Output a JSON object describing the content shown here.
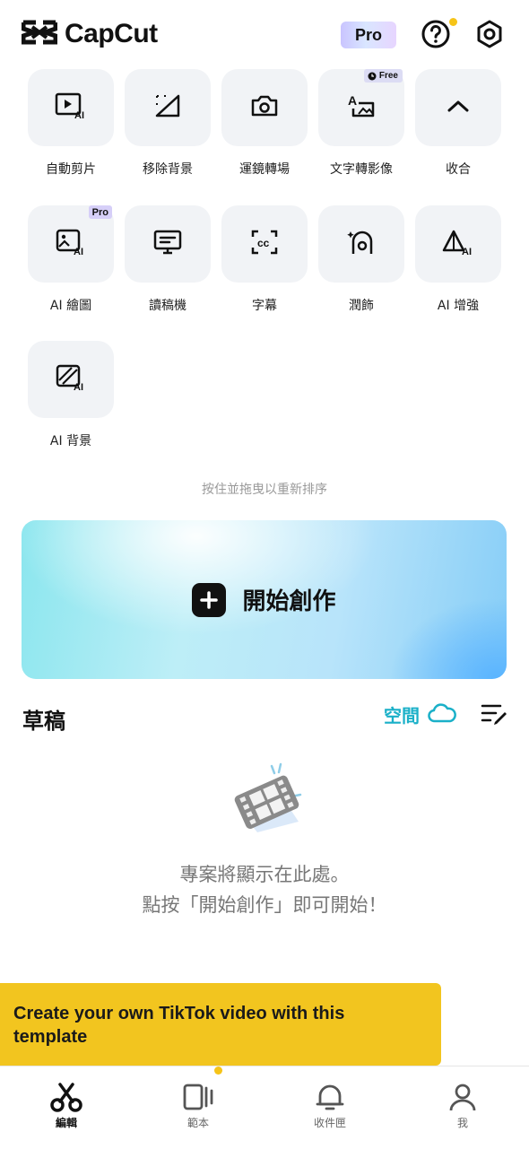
{
  "header": {
    "app_name": "CapCut",
    "pro_badge": "Pro"
  },
  "tools": [
    {
      "label": "自動剪片",
      "icon": "auto-cut-icon"
    },
    {
      "label": "移除背景",
      "icon": "remove-background-icon"
    },
    {
      "label": "運鏡轉場",
      "icon": "camera-icon"
    },
    {
      "label": "文字轉影像",
      "icon": "text-to-image-icon",
      "tag": "Free"
    },
    {
      "label": "收合",
      "icon": "chevron-up-icon"
    },
    {
      "label": "AI 繪圖",
      "icon": "ai-drawing-icon",
      "tag": "Pro"
    },
    {
      "label": "讀稿機",
      "icon": "teleprompter-icon"
    },
    {
      "label": "字幕",
      "icon": "captions-icon"
    },
    {
      "label": "潤飾",
      "icon": "retouch-icon"
    },
    {
      "label": "AI 增強",
      "icon": "ai-enhance-icon"
    },
    {
      "label": "AI 背景",
      "icon": "ai-background-icon"
    }
  ],
  "hint": "按住並拖曳以重新排序",
  "create": {
    "label": "開始創作"
  },
  "drafts": {
    "title": "草稿",
    "space_label": "空間",
    "empty_line1": "專案將顯示在此處。",
    "empty_line2": "點按「開始創作」即可開始！"
  },
  "tooltip": {
    "text": "Create your own TikTok video with this template"
  },
  "nav": [
    {
      "label": "編輯",
      "icon": "scissors-icon",
      "active": true
    },
    {
      "label": "範本",
      "icon": "template-icon",
      "active": false
    },
    {
      "label": "收件匣",
      "icon": "bell-icon",
      "active": false
    },
    {
      "label": "我",
      "icon": "profile-icon",
      "active": false
    }
  ],
  "colors": {
    "accent_yellow": "#F2C51F",
    "space_teal": "#1AB0C8",
    "tile_bg": "#F1F3F6"
  }
}
